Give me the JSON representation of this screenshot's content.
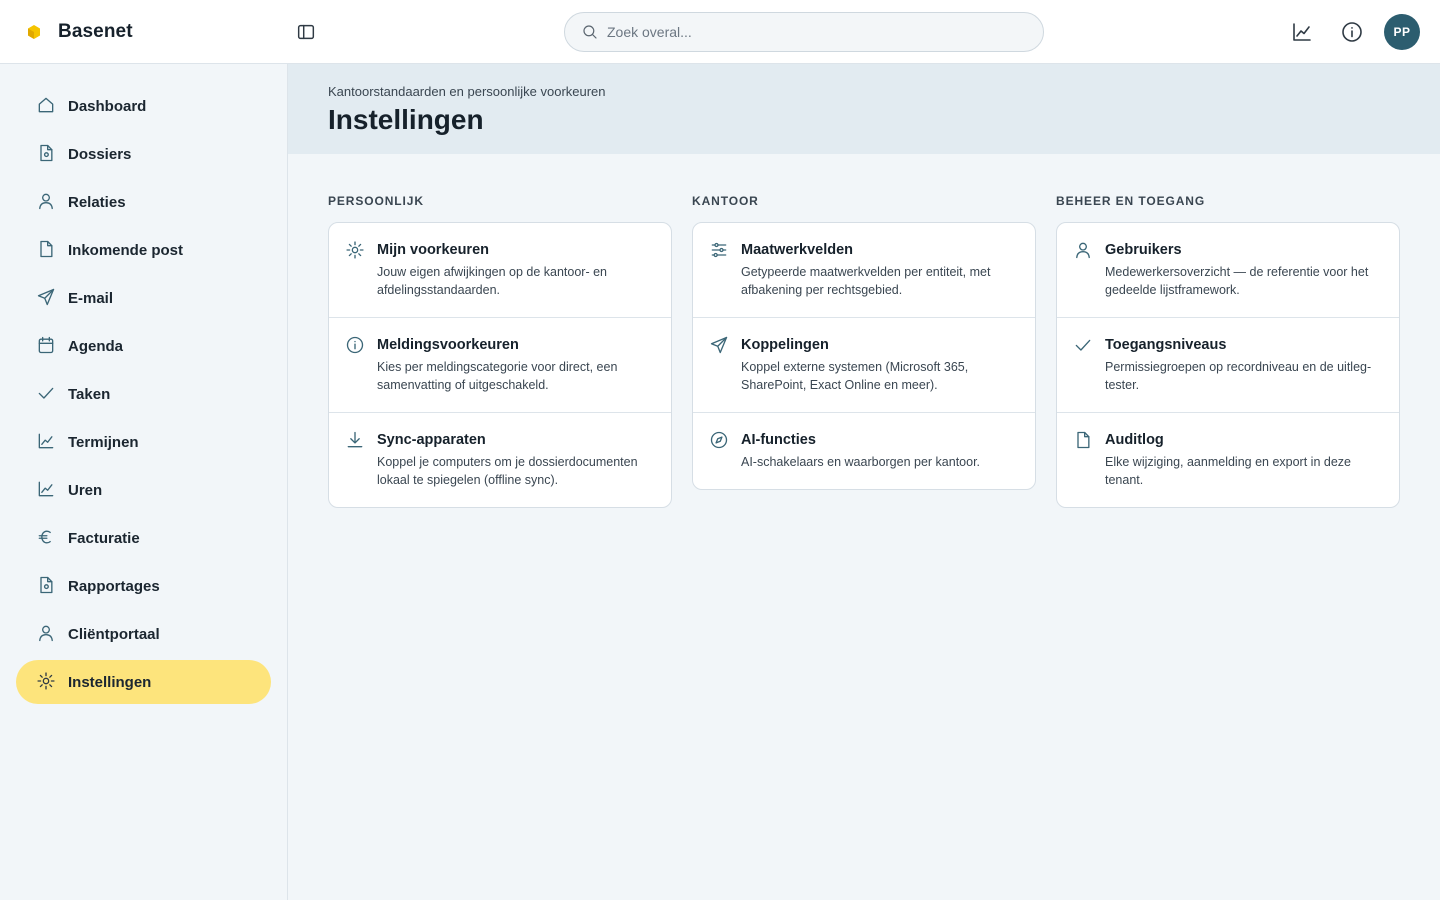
{
  "app": {
    "name": "Basenet",
    "accent_color": "#fde47c",
    "logo_color": "#f5c400"
  },
  "search": {
    "placeholder": "Zoek overal..."
  },
  "header_icons": [
    "chart-icon",
    "info-icon"
  ],
  "user": {
    "initials": "PP",
    "avatar_color": "#2c5d6f"
  },
  "sidebar": {
    "items": [
      {
        "label": "Dashboard",
        "icon": "home-icon",
        "active": false
      },
      {
        "label": "Dossiers",
        "icon": "file-icon",
        "active": false
      },
      {
        "label": "Relaties",
        "icon": "user-icon",
        "active": false
      },
      {
        "label": "Inkomende post",
        "icon": "document-icon",
        "active": false
      },
      {
        "label": "E-mail",
        "icon": "send-icon",
        "active": false
      },
      {
        "label": "Agenda",
        "icon": "calendar-icon",
        "active": false
      },
      {
        "label": "Taken",
        "icon": "check-icon",
        "active": false
      },
      {
        "label": "Termijnen",
        "icon": "chart-icon",
        "active": false
      },
      {
        "label": "Uren",
        "icon": "chart-icon",
        "active": false
      },
      {
        "label": "Facturatie",
        "icon": "euro-icon",
        "active": false
      },
      {
        "label": "Rapportages",
        "icon": "file-icon",
        "active": false
      },
      {
        "label": "Cliëntportaal",
        "icon": "user-icon",
        "active": false
      },
      {
        "label": "Instellingen",
        "icon": "settings-icon",
        "active": true
      }
    ]
  },
  "page": {
    "subtitle": "Kantoorstandaarden en persoonlijke voorkeuren",
    "title": "Instellingen"
  },
  "columns": [
    {
      "heading": "PERSOONLIJK",
      "items": [
        {
          "title": "Mijn voorkeuren",
          "desc": "Jouw eigen afwijkingen op de kantoor- en afdelingsstandaarden.",
          "icon": "settings-icon"
        },
        {
          "title": "Meldingsvoorkeuren",
          "desc": "Kies per meldingscategorie voor direct, een samenvatting of uitgeschakeld.",
          "icon": "info-icon"
        },
        {
          "title": "Sync-apparaten",
          "desc": "Koppel je computers om je dossierdocumenten lokaal te spiegelen (offline sync).",
          "icon": "download-icon"
        }
      ]
    },
    {
      "heading": "KANTOOR",
      "items": [
        {
          "title": "Maatwerkvelden",
          "desc": "Getypeerde maatwerkvelden per entiteit, met afbakening per rechtsgebied.",
          "icon": "sliders-icon"
        },
        {
          "title": "Koppelingen",
          "desc": "Koppel externe systemen (Microsoft 365, SharePoint, Exact Online en meer).",
          "icon": "send-icon"
        },
        {
          "title": "AI-functies",
          "desc": "AI-schakelaars en waarborgen per kantoor.",
          "icon": "compass-icon"
        }
      ]
    },
    {
      "heading": "BEHEER EN TOEGANG",
      "items": [
        {
          "title": "Gebruikers",
          "desc": "Medewerkersoverzicht — de referentie voor het gedeelde lijstframework.",
          "icon": "user-icon"
        },
        {
          "title": "Toegangsniveaus",
          "desc": "Permissiegroepen op recordniveau en de uitleg-tester.",
          "icon": "check-icon"
        },
        {
          "title": "Auditlog",
          "desc": "Elke wijziging, aanmelding en export in deze tenant.",
          "icon": "document-icon"
        }
      ]
    }
  ]
}
